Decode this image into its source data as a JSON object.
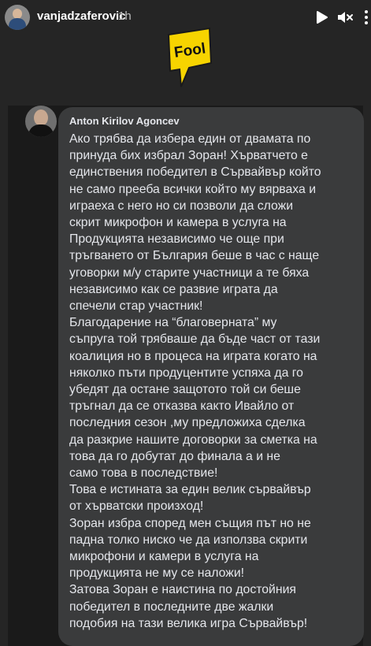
{
  "header": {
    "username": "vanjadzaferovic",
    "time": "1h"
  },
  "logo": {
    "text": "Fool"
  },
  "comment": {
    "author": "Anton Kirilov Agoncev",
    "text": "Ако трябва да избера един от двамата по\nпринуда бих избрал Зоран! Хърватчето е\nединствения победител в Сървайвър който\nне само прееба всички който му вярваха и\nиграеха с него но си позволи да сложи\nскрит микрофон и камера в услуга на\nПродукцията независимо че още при\nтръгването от България беше в час с наще\nуговорки м/у старите участници а те бяха\nнезависимо как се развие играта да\nспечели стар участник!\nБлагодарение на “благоверната” му\nсъпруга той трябваше да бъде част от тази\nкоалиция но в процеса на играта когато на\nняколко пъти продуцентите успяха да го\nубедят да остане защотото той си беше\nтръгнал да се отказва както Ивайло от\nпоследния сезон ,му предложиха сделка\nда разкрие нашите договорки за сметка на\nтова да го добутат до финала а и не\nсамо това в последствие!\nТова е истината за един велик сървайвър\nот хърватски произход!\nЗоран избра според мен същия път но не\nпадна толко ниско че да използва скрити\nмикрофони и камери в услуга на\nпродукцията не му се наложи!\nЗатова Зоран е наистина по достойния\nпобедител в последните две жалки\nподобия на тази велика игра Сървайвър!"
  }
}
